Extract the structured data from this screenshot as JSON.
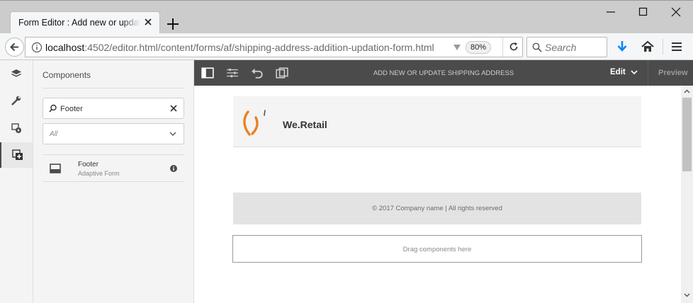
{
  "browser": {
    "tab_title": "Form Editor : Add new or update shipping address",
    "url": {
      "host": "localhost",
      "rest": ":4502/editor.html/content/forms/af/shipping-address-addition-updation-form.html"
    },
    "zoom": "80%",
    "search_placeholder": "Search"
  },
  "panel": {
    "title": "Components",
    "search_value": "Footer",
    "group_filter": "All",
    "components": [
      {
        "name": "Footer",
        "group": "Adaptive Form",
        "icon": "footer-component-icon"
      }
    ]
  },
  "editor": {
    "page_title": "ADD NEW OR UPDATE SHIPPING ADDRESS",
    "mode_label": "Edit",
    "preview_label": "Preview"
  },
  "canvas": {
    "brand_name": "We.Retail",
    "footer_text": "© 2017 Company name | All rights reserved",
    "drop_placeholder": "Drag components here"
  },
  "colors": {
    "toolbar": "#4b4b4b",
    "accent_download": "#0a84ff",
    "logo_orange": "#e8821e"
  }
}
